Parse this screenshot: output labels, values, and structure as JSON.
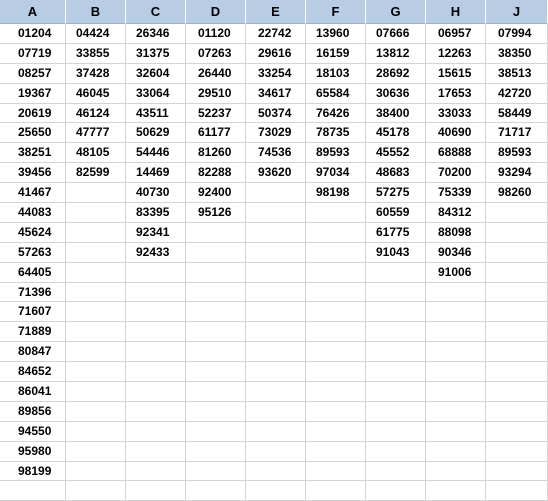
{
  "columns": [
    "A",
    "B",
    "C",
    "D",
    "E",
    "F",
    "G",
    "H",
    "J"
  ],
  "data": {
    "A": [
      "01204",
      "07719",
      "08257",
      "19367",
      "20619",
      "25650",
      "38251",
      "39456",
      "41467",
      "44083",
      "45624",
      "57263",
      "64405",
      "71396",
      "71607",
      "71889",
      "80847",
      "84652",
      "86041",
      "89856",
      "94550",
      "95980",
      "98199"
    ],
    "B": [
      "04424",
      "33855",
      "37428",
      "46045",
      "46124",
      "47777",
      "48105",
      "82599"
    ],
    "C": [
      "26346",
      "31375",
      "32604",
      "33064",
      "43511",
      "50629",
      "54446",
      "14469",
      "40730",
      "83395",
      "92341",
      "92433"
    ],
    "D": [
      "01120",
      "07263",
      "26440",
      "29510",
      "52237",
      "61177",
      "81260",
      "82288",
      "92400",
      "95126"
    ],
    "E": [
      "22742",
      "29616",
      "33254",
      "34617",
      "50374",
      "73029",
      "74536",
      "93620"
    ],
    "F": [
      "13960",
      "16159",
      "18103",
      "65584",
      "76426",
      "78735",
      "89593",
      "97034",
      "98198"
    ],
    "G": [
      "07666",
      "13812",
      "28692",
      "30636",
      "38400",
      "45178",
      "45552",
      "48683",
      "57275",
      "60559",
      "61775",
      "91043"
    ],
    "H": [
      "06957",
      "12263",
      "15615",
      "17653",
      "33033",
      "40690",
      "68888",
      "70200",
      "75339",
      "84312",
      "88098",
      "90346",
      "91006"
    ],
    "J": [
      "07994",
      "38350",
      "38513",
      "42720",
      "58449",
      "71717",
      "89593",
      "93294",
      "98260"
    ]
  }
}
